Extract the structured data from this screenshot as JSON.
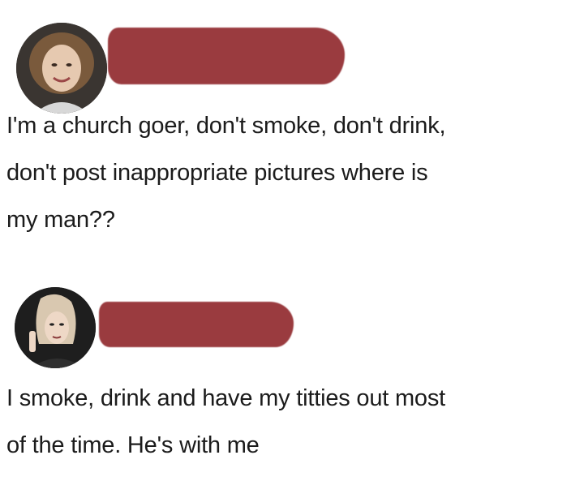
{
  "posts": [
    {
      "author_redacted": true,
      "redaction_color": "#9a3b3f",
      "avatar": "profile-photo-woman",
      "text": "I'm a church goer, don't smoke, don't drink,\ndon't post inappropriate pictures where is\nmy man??"
    },
    {
      "author_redacted": true,
      "redaction_color": "#9a3b3f",
      "avatar": "profile-photo-woman-smoking",
      "text": "I smoke, drink and have my titties out most\nof the time. He's with me"
    }
  ]
}
